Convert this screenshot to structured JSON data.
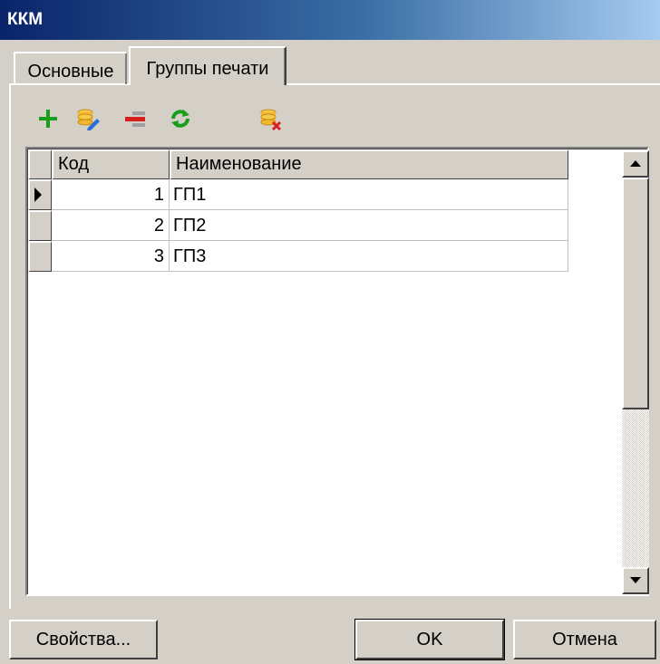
{
  "window": {
    "title": "ККМ"
  },
  "tabs": [
    {
      "label": "Основные",
      "active": false
    },
    {
      "label": "Группы печати",
      "active": true
    }
  ],
  "toolbar": {
    "icons": [
      "add-icon",
      "edit-record-icon",
      "delete-row-icon",
      "refresh-icon",
      "delete-record-icon"
    ]
  },
  "grid": {
    "columns": [
      "Код",
      "Наименование"
    ],
    "rows": [
      {
        "code": "1",
        "name": "ГП1",
        "current": true
      },
      {
        "code": "2",
        "name": "ГП2",
        "current": false
      },
      {
        "code": "3",
        "name": "ГП3",
        "current": false
      }
    ]
  },
  "buttons": {
    "properties": "Свойства...",
    "ok": "OK",
    "cancel": "Отмена"
  },
  "colors": {
    "title_gradient_start": "#0a246a",
    "title_gradient_end": "#a6caf0",
    "window_face": "#d4d0c8",
    "add_green": "#1a9e1a",
    "delete_red": "#d62020"
  }
}
